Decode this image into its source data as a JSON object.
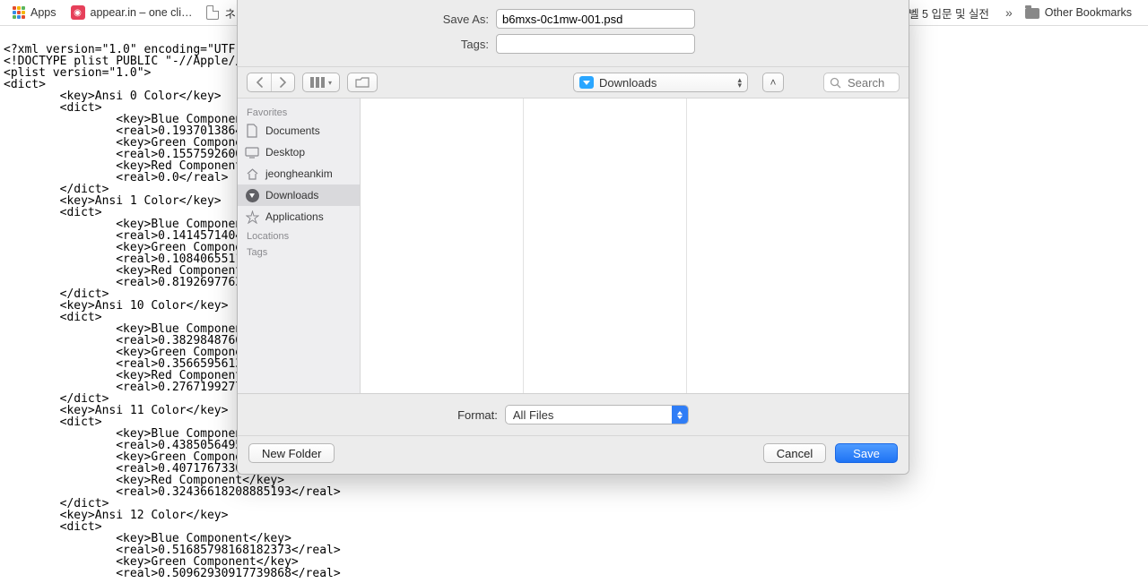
{
  "bookmarks": {
    "apps": "Apps",
    "appear": "appear.in – one cli…",
    "netd": "ネットd",
    "right": "벨 5 입문 및 실전",
    "other": "Other Bookmarks",
    "more": "»"
  },
  "dialog": {
    "saveAsLabel": "Save As:",
    "tagsLabel": "Tags:",
    "filename": "b6mxs-0c1mw-001.psd",
    "location": "Downloads",
    "searchPlaceholder": "Search",
    "formatLabel": "Format:",
    "formatValue": "All Files",
    "newFolder": "New Folder",
    "cancel": "Cancel",
    "save": "Save",
    "sidebar": {
      "favorites": "Favorites",
      "locations": "Locations",
      "tags": "Tags",
      "items": {
        "documents": "Documents",
        "desktop": "Desktop",
        "home": "jeongheankim",
        "downloads": "Downloads",
        "applications": "Applications"
      }
    }
  },
  "code": "<?xml version=\"1.0\" encoding=\"UTF-8\"?>\n<!DOCTYPE plist PUBLIC \"-//Apple//DTD\n<plist version=\"1.0\">\n<dict>\n        <key>Ansi 0 Color</key>\n        <dict>\n                <key>Blue Component</key>\n                <real>0.19370138645172\n                <key>Green Component</key>\n                <real>0.15575926005840\n                <key>Red Component</key>\n                <real>0.0</real>\n        </dict>\n        <key>Ansi 1 Color</key>\n        <dict>\n                <key>Blue Component</key>\n                <real>0.14145714044570\n                <key>Green Component</key>\n                <real>0.10840655118227\n                <key>Red Component</key>\n                <real>0.81926977634429\n        </dict>\n        <key>Ansi 10 Color</key>\n        <dict>\n                <key>Blue Component</key>\n                <real>0.38298487663269\n                <key>Green Component</key>\n                <real>0.35665956139564\n                <key>Red Component</key>\n                <real>0.27671992778778\n        </dict>\n        <key>Ansi 11 Color</key>\n        <dict>\n                <key>Blue Component</key>\n                <real>0.43850564956665\n                <key>Green Component</key>\n                <real>0.40717673301696....~~~~~\n                <key>Red Component</key>\n                <real>0.32436618208885193</real>\n        </dict>\n        <key>Ansi 12 Color</key>\n        <dict>\n                <key>Blue Component</key>\n                <real>0.51685798168182373</real>\n                <key>Green Component</key>\n                <real>0.50962930917739868</real>"
}
